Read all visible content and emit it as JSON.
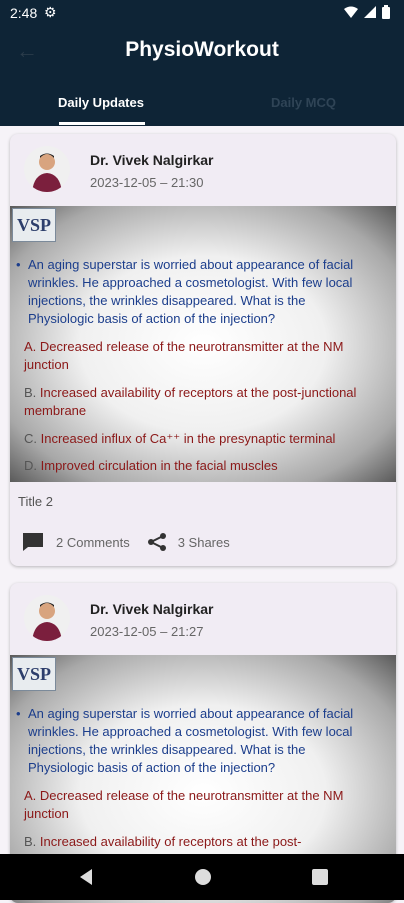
{
  "status_bar": {
    "time": "2:48"
  },
  "app": {
    "title": "PhysioWorkout"
  },
  "tabs": [
    "Daily Updates",
    "Daily MCQ"
  ],
  "posts": [
    {
      "author": "Dr. Vivek Nalgirkar",
      "date": "2023-12-05 – 21:30",
      "slide": {
        "logo": "VSP",
        "question": "An aging superstar is worried about appearance of facial wrinkles. He approached a cosmetologist. With few local injections, the wrinkles disappeared. What is the Physiologic basis of action of the injection?",
        "options": [
          {
            "label": "A.",
            "text": "Decreased release of the neurotransmitter at the NM junction"
          },
          {
            "label": "B.",
            "text": "Increased availability of receptors at the post-junctional membrane"
          },
          {
            "label": "C.",
            "text": "Increased influx of Ca⁺⁺ in the presynaptic terminal"
          },
          {
            "label": "D.",
            "text": "Improved circulation in the facial muscles"
          }
        ]
      },
      "caption": "Title 2",
      "comments": "2 Comments",
      "shares": "3 Shares"
    },
    {
      "author": "Dr. Vivek Nalgirkar",
      "date": "2023-12-05 – 21:27",
      "slide": {
        "logo": "VSP",
        "question": "An aging superstar is worried about appearance of facial wrinkles. He approached a cosmetologist. With few local injections, the wrinkles disappeared. What is the Physiologic basis of action of the injection?",
        "options": [
          {
            "label": "A.",
            "text": "Decreased release of the neurotransmitter at the NM junction"
          },
          {
            "label": "B.",
            "text": "Increased availability of receptors at the post-"
          }
        ]
      }
    }
  ]
}
